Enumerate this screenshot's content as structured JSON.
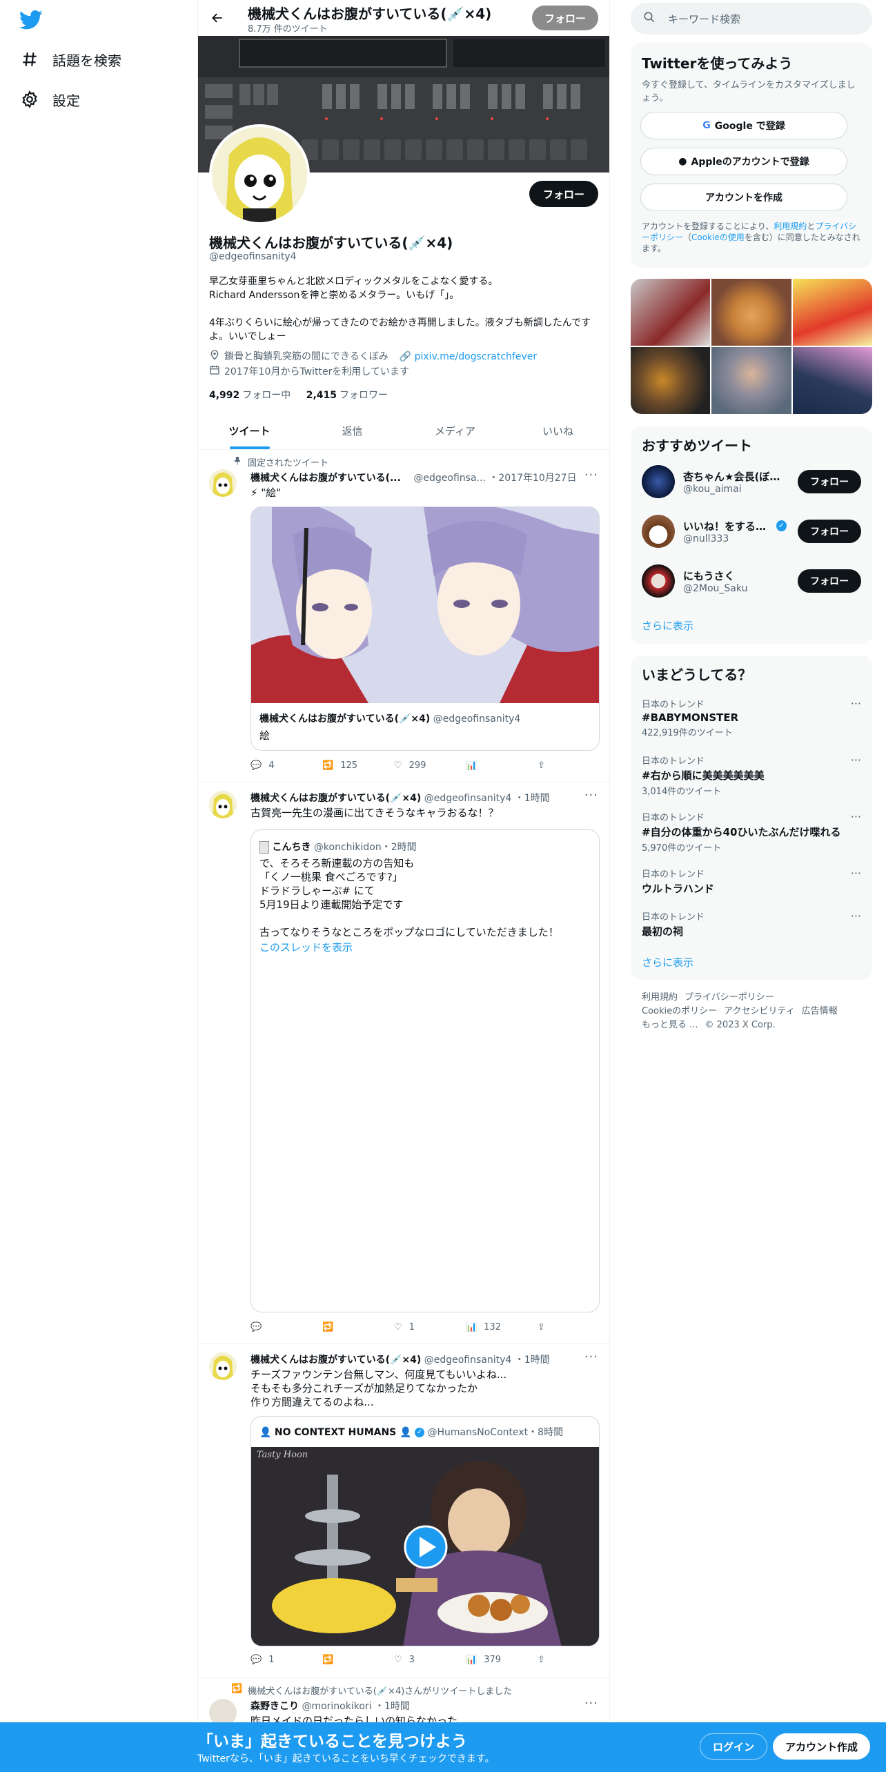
{
  "colors": {
    "accent": "#1d9bf0",
    "text": "#0f1419",
    "muted": "#536471"
  },
  "leftnav": {
    "logo": "twitter-bird-icon",
    "items": [
      {
        "label": "話題を検索",
        "icon": "hash-icon"
      },
      {
        "label": "設定",
        "icon": "gear-icon"
      }
    ]
  },
  "header": {
    "name": "機械犬くんはお腹がすいている(💉×4)",
    "tweet_count": "8.7万 件のツイート",
    "follow_label": "フォロー"
  },
  "profile": {
    "follow_label": "フォロー",
    "name": "機械犬くんはお腹がすいている(💉×4)",
    "handle": "@edgeofinsanity4",
    "bio": [
      "早乙女芽亜里ちゃんと北欧メロディックメタルをこよなく愛する。",
      "Richard Anderssonを神と崇めるメタラー。いもげ「」。",
      "",
      "4年ぶりくらいに絵心が帰ってきたのでお絵かき再開しました。液タブも新調したんですよ。いいでしょー"
    ],
    "location": "鎖骨と胸鎖乳突筋の間にできるくぼみ",
    "link": "pixiv.me/dogscratchfever",
    "joined": "2017年10月からTwitterを利用しています",
    "following_count": "4,992",
    "following_label": "フォロー中",
    "followers_count": "2,415",
    "followers_label": "フォロワー"
  },
  "tabs": [
    {
      "label": "ツイート",
      "active": true
    },
    {
      "label": "返信",
      "active": false
    },
    {
      "label": "メディア",
      "active": false
    },
    {
      "label": "いいね",
      "active": false
    }
  ],
  "tweets": [
    {
      "pinned_label": "固定されたツイート",
      "name": "機械犬くんはお腹がすいている(...",
      "handle": "@edgeofinsa...",
      "time": "・2017年10月27日",
      "text": "⚡ \"絵\"",
      "quote_name": "機械犬くんはお腹がすいている(💉×4)",
      "quote_handle": "@edgeofinsanity4",
      "quote_text": "絵",
      "replies": "4",
      "retweets": "125",
      "likes": "299",
      "views": ""
    },
    {
      "name": "機械犬くんはお腹がすいている(💉×4)",
      "handle": "@edgeofinsanity4",
      "time": "・1時間",
      "text": "古賀亮一先生の漫画に出てきそうなキャラおるな！？",
      "quote_name": "こんちき",
      "quote_handle": "@konchikidon",
      "quote_time": "・2時間",
      "quote_lines": [
        "で、そろそろ新連載の方の告知も",
        "「くノ一桃果 食べごろです?」",
        "ドラドラしゃーぷ# にて",
        "5月19日より連載開始予定です",
        "",
        "古ってなりそうなところをポップなロゴにしていただきました！"
      ],
      "thread_link": "このスレッドを表示",
      "replies": "",
      "retweets": "",
      "likes": "1",
      "views": "132"
    },
    {
      "name": "機械犬くんはお腹がすいている(💉×4)",
      "handle": "@edgeofinsanity4",
      "time": "・1時間",
      "text_lines": [
        "チーズファウンテン台無しマン、何度見てもいいよね...",
        "そもそも多分これチーズが加熱足りてなかったか",
        "作り方間違えてるのよね..."
      ],
      "quote_name": "NO CONTEXT HUMANS 👤",
      "quote_handle": "@HumansNoContext",
      "quote_time": "・8時間",
      "video_watermark": "Tasty Hoon",
      "replies": "1",
      "retweets": "",
      "likes": "3",
      "views": "379"
    },
    {
      "retweet_label": "機械犬くんはお腹がすいている(💉×4)さんがリツイートしました",
      "name": "森野きこり",
      "handle": "@morinokikori",
      "time": "・1時間",
      "text": "昨日メイドの日だったらしいの知らなかった"
    }
  ],
  "right": {
    "search_placeholder": "キーワード検索",
    "signup": {
      "title": "Twitterを使ってみよう",
      "subtitle": "今すぐ登録して、タイムラインをカスタマイズしましょう。",
      "google": "Google で登録",
      "apple": "Appleのアカウントで登録",
      "create": "アカウントを作成",
      "legal_pre": "アカウントを登録することにより、",
      "legal_terms": "利用規約",
      "legal_mid": "と",
      "legal_privacy": "プライバシーポリシー",
      "legal_cookie_pre": "（",
      "legal_cookie": "Cookieの使用",
      "legal_post": "を含む）に同意したとみなされます。"
    },
    "recommend": {
      "title": "おすすめツイート",
      "users": [
        {
          "name": "杏ちゃん★会長(ぼつ...",
          "handle": "@kou_aimai",
          "follow": "フォロー",
          "verified": false
        },
        {
          "name": "いいね！をするパ...",
          "handle": "@null333",
          "follow": "フォロー",
          "verified": true
        },
        {
          "name": "にもうさく",
          "handle": "@2Mou_Saku",
          "follow": "フォロー",
          "verified": false
        }
      ],
      "more": "さらに表示"
    },
    "trends": {
      "title": "いまどうしてる？",
      "items": [
        {
          "category": "日本のトレンド",
          "name": "#BABYMONSTER",
          "count": "422,919件のツイート"
        },
        {
          "category": "日本のトレンド",
          "name": "#右から順に美美美美美美",
          "count": "3,014件のツイート"
        },
        {
          "category": "日本のトレンド",
          "name": "#自分の体重から40ひいたぶんだけ喋れる",
          "count": "5,970件のツイート"
        },
        {
          "category": "日本のトレンド",
          "name": "ウルトラハンド",
          "count": ""
        },
        {
          "category": "日本のトレンド",
          "name": "最初の祠",
          "count": ""
        }
      ],
      "more": "さらに表示"
    },
    "footer": {
      "links": [
        "利用規約",
        "プライバシーポリシー",
        "Cookieのポリシー",
        "アクセシビリティ",
        "広告情報",
        "もっと見る ..."
      ],
      "copyright": "© 2023 X Corp."
    }
  },
  "bottom": {
    "title": "「いま」起きていることを見つけよう",
    "subtitle": "Twitterなら、「いま」起きていることをいち早くチェックできます。",
    "login": "ログイン",
    "signup": "アカウント作成"
  }
}
